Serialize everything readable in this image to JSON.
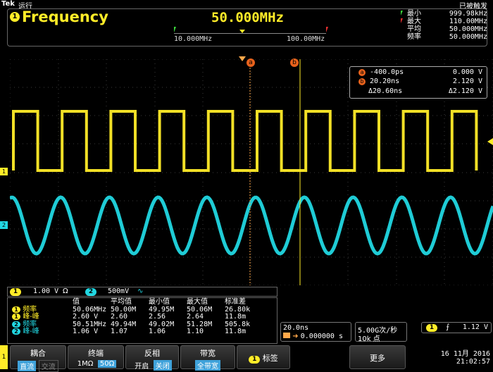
{
  "header": {
    "brand": "Tek",
    "run_status": "运行",
    "trigger_status": "已被触发"
  },
  "frequency_panel": {
    "badge": "1",
    "title": "Frequency",
    "value": "50.000MHz",
    "range_low": "10.000MHz",
    "range_high": "100.00MHz",
    "stats": [
      {
        "label": "最小",
        "value": "999.98kHz"
      },
      {
        "label": "最大",
        "value": "110.00MHz"
      },
      {
        "label": "平均",
        "value": "50.000MHz"
      },
      {
        "label": "频率",
        "value": "50.000MHz"
      }
    ]
  },
  "cursors": {
    "a": {
      "label": "a",
      "time": "-400.0ps",
      "volt": "0.000 V"
    },
    "b": {
      "label": "b",
      "time": "20.20ns",
      "volt": "2.120 V"
    },
    "delta": {
      "time": "Δ20.60ns",
      "volt": "Δ2.120 V"
    }
  },
  "channels": {
    "ch1": {
      "num": "1",
      "scale": "1.00 V",
      "coupling": "Ω"
    },
    "ch2": {
      "num": "2",
      "scale": "500mV",
      "coupling": "∿"
    }
  },
  "measurements": {
    "headers": [
      "值",
      "平均值",
      "最小值",
      "最大值",
      "标准差"
    ],
    "rows": [
      {
        "ch": "1",
        "name": "频率",
        "value": "50.06MHz",
        "mean": "50.00M",
        "min": "49.95M",
        "max": "50.06M",
        "std": "26.80k"
      },
      {
        "ch": "1",
        "name": "峰-峰",
        "value": "2.60 V",
        "mean": "2.60",
        "min": "2.56",
        "max": "2.64",
        "std": "11.8m"
      },
      {
        "ch": "2",
        "name": "频率",
        "value": "50.51MHz",
        "mean": "49.94M",
        "min": "49.02M",
        "max": "51.28M",
        "std": "505.8k"
      },
      {
        "ch": "2",
        "name": "峰-峰",
        "value": "1.06 V",
        "mean": "1.07",
        "min": "1.06",
        "max": "1.10",
        "std": "11.8m"
      }
    ]
  },
  "timebase": {
    "scale": "20.0ns",
    "position": "0.000000 s"
  },
  "acquisition": {
    "rate": "5.00G次/秒",
    "record": "10k 点"
  },
  "trigger": {
    "source": "1",
    "slope": "⨍",
    "level": "1.12 V"
  },
  "menu": {
    "coupling_label": "耦合",
    "coupling_dc": "直流",
    "coupling_ac": "交流",
    "termination_label": "终端",
    "termination_1m": "1MΩ",
    "termination_50": "50Ω",
    "invert_label": "反相",
    "invert_on": "开启",
    "invert_off": "关闭",
    "bandwidth_label": "带宽",
    "bandwidth_value": "全带宽",
    "tags_label": "标签",
    "more_label": "更多",
    "channel_tab": "1"
  },
  "datetime": {
    "date": "16 11月 2016",
    "time": "21:02:57"
  },
  "colors": {
    "ch1": "#ffec28",
    "ch2": "#21d7e2",
    "cursor": "#e8621c",
    "select": "#3fa2da"
  }
}
